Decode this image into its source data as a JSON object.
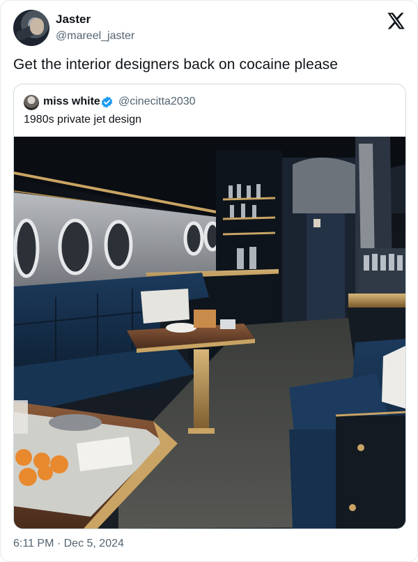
{
  "tweet": {
    "author_name": "Jaster",
    "author_handle": "@mareel_jaster",
    "text": "Get the interior designers back on cocaine please",
    "timestamp": "6:11 PM · Dec 5, 2024"
  },
  "quoted_tweet": {
    "author_name": "miss white",
    "author_handle": "@cinecitta2030",
    "verified": true,
    "text": "1980s private jet design"
  },
  "colors": {
    "text_primary": "#0f1419",
    "text_secondary": "#536471",
    "border": "#cfd9de",
    "verified_blue": "#1d9bf0"
  },
  "icons": {
    "logo": "x-logo-icon",
    "badge": "verified-badge-icon"
  }
}
